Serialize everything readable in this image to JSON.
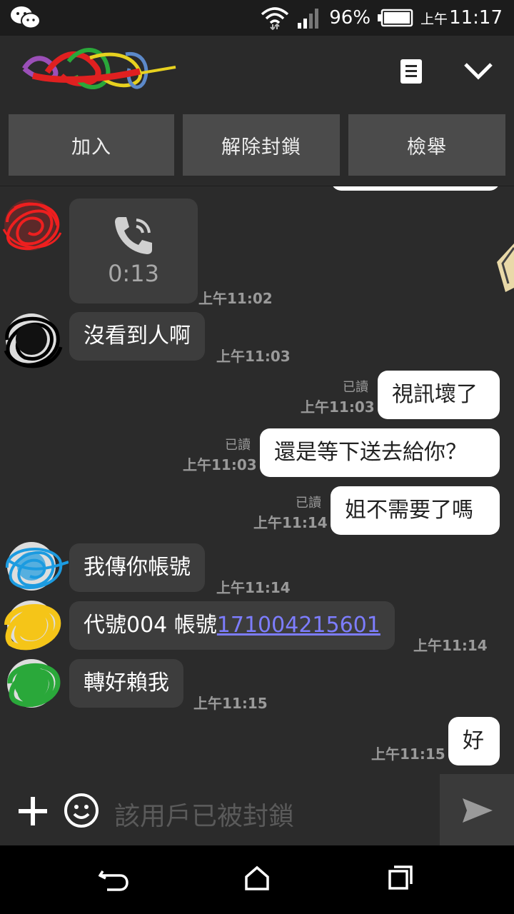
{
  "status_bar": {
    "battery": "96%",
    "time_prefix": "上午",
    "time": "11:17"
  },
  "header": {
    "icons": [
      "notes-icon",
      "chevron-down-icon"
    ]
  },
  "actions": {
    "add": "加入",
    "unblock": "解除封鎖",
    "report": "檢舉"
  },
  "call": {
    "duration": "0:13",
    "time": "上午11:02"
  },
  "messages": [
    {
      "side": "in",
      "text": "沒看到人啊",
      "time": "上午11:03"
    },
    {
      "side": "out",
      "text": "視訊壞了",
      "read": "已讀",
      "time": "上午11:03"
    },
    {
      "side": "out",
      "text": "還是等下送去給你？",
      "read": "已讀",
      "time": "上午11:03"
    },
    {
      "side": "out",
      "text": "姐不需要了嗎",
      "read": "已讀",
      "time": "上午11:14"
    },
    {
      "side": "in",
      "text": "我傳你帳號",
      "time": "上午11:14"
    },
    {
      "side": "in",
      "text": "代號004 帳號",
      "link": "171004215601",
      "time": "上午11:14"
    },
    {
      "side": "in",
      "text": "轉好賴我",
      "time": "上午11:15"
    },
    {
      "side": "out",
      "text": "好",
      "time": "上午11:15"
    }
  ],
  "input": {
    "placeholder": "該用戶已被封鎖"
  },
  "colors": {
    "background": "#2b2b2b",
    "incoming_bubble": "#3d3d3d",
    "outgoing_bubble": "#ffffff",
    "link": "#7d7dff",
    "action_button": "#4b4b4b"
  }
}
